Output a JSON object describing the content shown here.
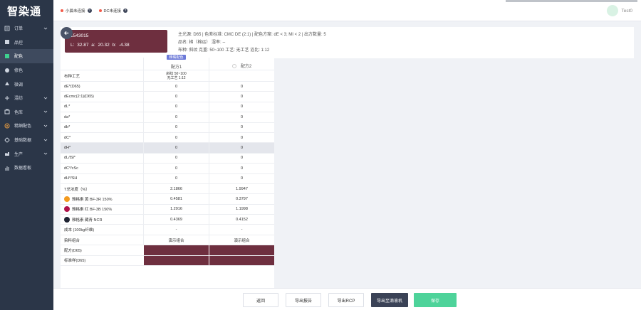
{
  "app": {
    "logo": "智染通"
  },
  "sidebar": {
    "items": [
      {
        "label": "订单",
        "icon": "order-icon",
        "has_children": true
      },
      {
        "label": "品控",
        "icon": "quality-icon",
        "has_children": false
      },
      {
        "label": "配色",
        "icon": "color-match-icon",
        "has_children": false,
        "active": true
      },
      {
        "label": "修色",
        "icon": "color-correct-icon",
        "has_children": false
      },
      {
        "label": "微调",
        "icon": "fine-tune-icon",
        "has_children": false
      },
      {
        "label": "混纺",
        "icon": "blend-icon",
        "has_children": true
      },
      {
        "label": "色库",
        "icon": "color-library-icon",
        "has_children": true
      },
      {
        "label": "精细配色",
        "icon": "fine-match-icon",
        "has_children": true
      },
      {
        "label": "基础数据",
        "icon": "base-data-icon",
        "has_children": true
      },
      {
        "label": "生产",
        "icon": "production-icon",
        "has_children": true
      },
      {
        "label": "数据看板",
        "icon": "dashboard-icon",
        "has_children": false
      }
    ]
  },
  "header": {
    "status1": "小晨未连接",
    "status2": "DC未连接",
    "user": "Test0"
  },
  "sample": {
    "id": "1543015",
    "lab": "L: 32.87   a: 20.32   b: -4.38",
    "color": "#6e2f3f"
  },
  "meta": {
    "row1": "主光源: D65  |  色差标准: CMC DE (2:1)  |  配色方案: dE < 3; MI < 2  |  出方数量: 5",
    "row2": "品名: 棉（棉运）       湿率: --",
    "row3": "布种: 斜纹     克重: 50~100     工艺: 无工艺     浴比: 1:12"
  },
  "table": {
    "badge": "精确配色",
    "col1": "配方1",
    "col2": "配方2",
    "process_label": "布种工艺",
    "process_line1": "斜纹 50~100",
    "process_line2": "无工艺 1:12",
    "rows": [
      {
        "label": "dE*(D65)",
        "v1": "0",
        "v2": "0"
      },
      {
        "label": "dEcmc(2:1)(D65)",
        "v1": "0",
        "v2": "0"
      },
      {
        "label": "dL*",
        "v1": "0",
        "v2": "0"
      },
      {
        "label": "da*",
        "v1": "0",
        "v2": "0"
      },
      {
        "label": "db*",
        "v1": "0",
        "v2": "0"
      },
      {
        "label": "dC*",
        "v1": "0",
        "v2": "0"
      },
      {
        "label": "dH*",
        "v1": "0",
        "v2": "0",
        "highlight": true
      },
      {
        "label": "dL/lSl*",
        "v1": "0",
        "v2": "0"
      },
      {
        "label": "dC*/cSc",
        "v1": "0",
        "v2": "0"
      },
      {
        "label": "dH*/SH",
        "v1": "0",
        "v2": "0"
      },
      {
        "label": "T总浓度（%）",
        "v1": "2.1866",
        "v2": "1.9947"
      }
    ],
    "dyes": [
      {
        "label": "雅格素 黄 BF-3R 150%",
        "color": "#f39a1e",
        "v1": "0.4581",
        "v2": "0.3797"
      },
      {
        "label": "雅格素 红 BF-3B 150%",
        "color": "#b0124a",
        "v1": "1.2916",
        "v2": "1.1998"
      },
      {
        "label": "雅格素 藏青 NCR",
        "color": "#1f2433",
        "v1": "0.4369",
        "v2": "0.4152"
      }
    ],
    "cost": {
      "label": "成本 (100kg纤维)",
      "v1": "-",
      "v2": "-"
    },
    "dye_combo": {
      "label": "染料组合",
      "v1": "演示组合",
      "v2": "演示组合"
    },
    "formula_label": "配方(D65)",
    "standard_label": "标准样(D65)",
    "swatch_color": "#6e2f3f"
  },
  "footer": {
    "back": "返回",
    "export_report": "导出报告",
    "export_rcp": "导出RCP",
    "export_machine": "导出至滴液机",
    "save": "保存"
  }
}
